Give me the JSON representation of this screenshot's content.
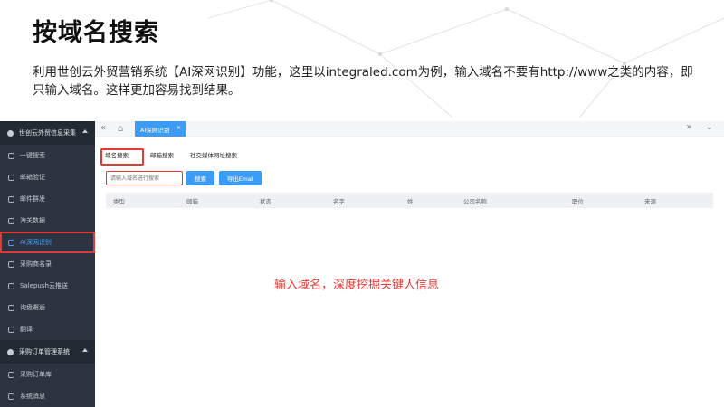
{
  "slide": {
    "title": "按域名搜索",
    "description": "利用世创云外贸营销系统【AI深网识别】功能，这里以integraled.com为例，输入域名不要有http://www之类的内容，即只输入域名。这样更加容易找到结果。",
    "annotation": "输入域名，深度挖掘关键人信息",
    "accent_color": "#e53935"
  },
  "sidebar": {
    "section1": {
      "label": "世创云外贸信息采集",
      "icon": "star-icon"
    },
    "items1": [
      {
        "label": "一键搜索",
        "icon": "search-icon"
      },
      {
        "label": "邮箱验证",
        "icon": "question-icon"
      },
      {
        "label": "邮件群发",
        "icon": "send-icon"
      },
      {
        "label": "海关数据",
        "icon": "chart-icon"
      },
      {
        "label": "AI深网识别",
        "icon": "ai-icon",
        "active": true
      },
      {
        "label": "采购商名录",
        "icon": "user-icon"
      },
      {
        "label": "Salepush云推送",
        "icon": "refresh-icon"
      },
      {
        "label": "询盘邂逅",
        "icon": "message-icon"
      },
      {
        "label": "翻译",
        "icon": "translate-icon"
      }
    ],
    "section2": {
      "label": "采购订单管理系统",
      "icon": "gear-icon"
    },
    "items2": [
      {
        "label": "采购订单库",
        "icon": "list-icon"
      },
      {
        "label": "系统消息",
        "icon": "chat-icon"
      }
    ]
  },
  "topbar": {
    "active_tab": "AI深网识别",
    "tab_close": "×",
    "nav_left": "«",
    "nav_right": "» ⌄"
  },
  "subtabs": [
    "域名搜索",
    "邮箱搜索",
    "社交媒体网址搜索"
  ],
  "search": {
    "placeholder": "请输入域名进行搜索",
    "search_button": "搜索",
    "export_button": "导出Email"
  },
  "table": {
    "columns": [
      "类型",
      "邮箱",
      "状态",
      "名字",
      "姓",
      "公司名称",
      "职位",
      "来源"
    ]
  }
}
